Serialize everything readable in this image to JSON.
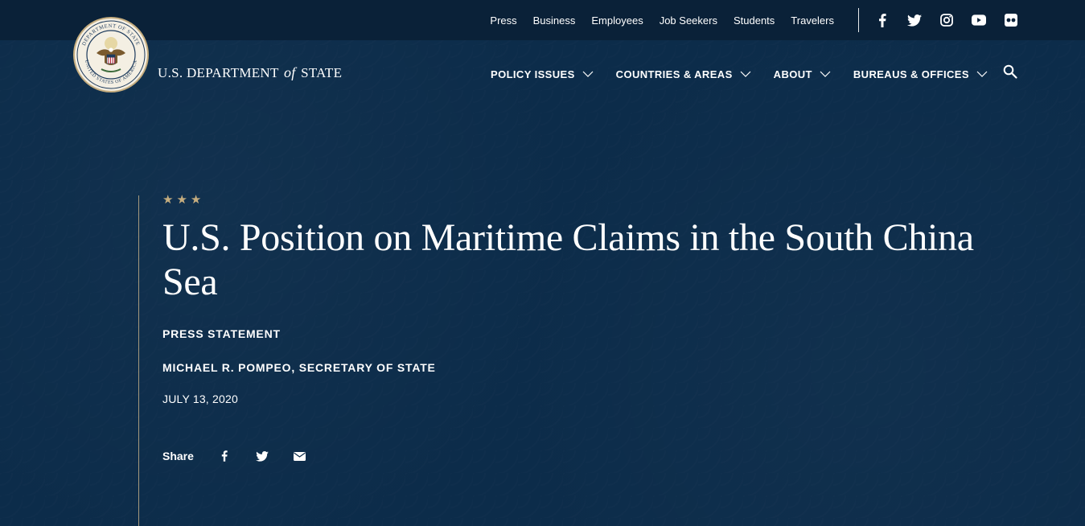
{
  "utility_nav": {
    "links": [
      "Press",
      "Business",
      "Employees",
      "Job Seekers",
      "Students",
      "Travelers"
    ]
  },
  "social": [
    "facebook-icon",
    "twitter-icon",
    "instagram-icon",
    "youtube-icon",
    "flickr-icon"
  ],
  "brand": {
    "pre": "U.S. DEPARTMENT",
    "of": "of",
    "post": "STATE",
    "seal_text_top": "DEPARTMENT OF STATE",
    "seal_text_bottom": "UNITED STATES OF AMERICA"
  },
  "main_nav": {
    "items": [
      "POLICY ISSUES",
      "COUNTRIES & AREAS",
      "ABOUT",
      "BUREAUS & OFFICES"
    ]
  },
  "hero": {
    "stars": "★★★",
    "title": "U.S. Position on Maritime Claims in the South China Sea",
    "type": "PRESS STATEMENT",
    "author": "MICHAEL R. POMPEO, SECRETARY OF STATE",
    "date": "JULY 13, 2020"
  },
  "share": {
    "label": "Share",
    "icons": [
      "facebook-icon",
      "twitter-icon",
      "email-icon"
    ]
  },
  "colors": {
    "background": "#0c2c4a",
    "utility_bar": "#0a2138",
    "accent_gold": "#c5ad7f",
    "text": "#ffffff"
  }
}
